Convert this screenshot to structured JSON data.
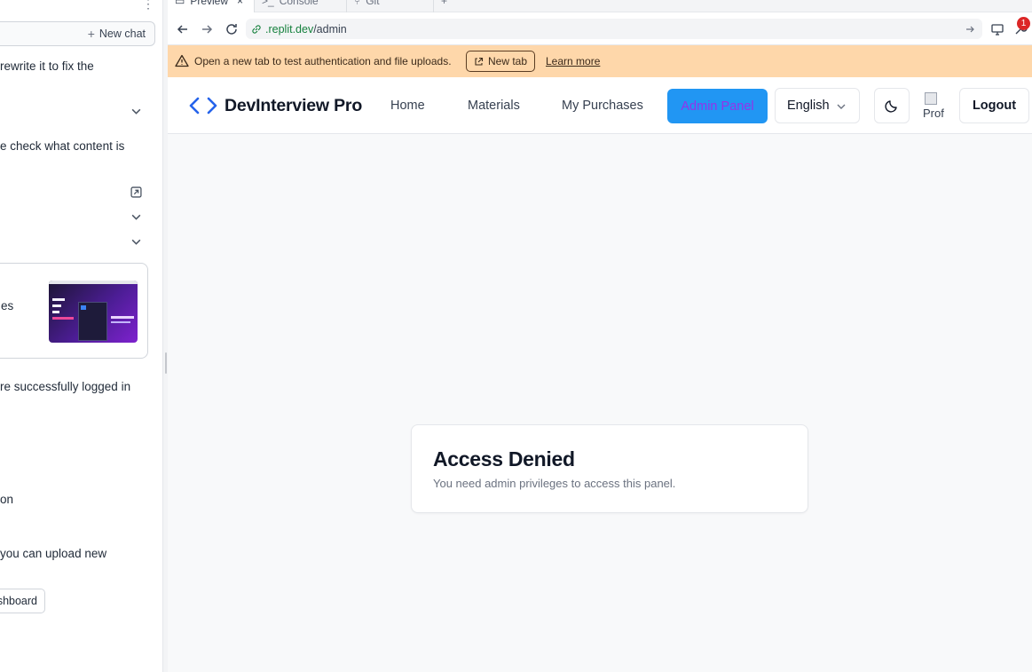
{
  "chat": {
    "new_chat_label": "New chat",
    "lines": [
      "rewrite it to fix the",
      "e check what content is",
      "es",
      "re successfully logged in",
      "on",
      " you can upload new"
    ],
    "dashboard_button": "shboard"
  },
  "browser": {
    "tabs": [
      "Preview",
      "Console",
      "Git"
    ],
    "url_host": ".replit.dev",
    "url_path": "/admin",
    "notification_count": "1"
  },
  "banner": {
    "message": "Open a new tab to test authentication and file uploads.",
    "new_tab_label": "New tab",
    "learn_more_label": "Learn more"
  },
  "app": {
    "brand": "DevInterview Pro",
    "nav": {
      "home": "Home",
      "materials": "Materials",
      "purchases": "My Purchases",
      "admin": "Admin Panel"
    },
    "language": "English",
    "avatar_alt": "Prof",
    "logout": "Logout"
  },
  "content": {
    "title": "Access Denied",
    "message": "You need admin privileges to access this panel."
  },
  "colors": {
    "admin_button_bg": "#2196f3",
    "admin_button_text": "#9333ea",
    "banner_bg": "#fed7aa",
    "brand_icon": "#2563eb"
  }
}
